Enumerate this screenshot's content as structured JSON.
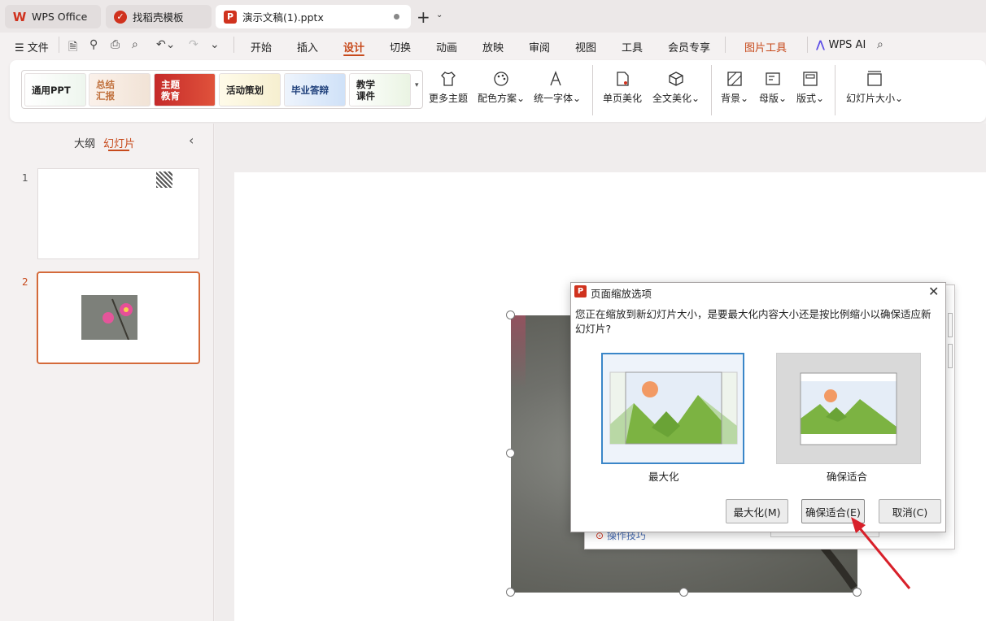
{
  "tabs": {
    "wps": "WPS Office",
    "templates": "找稻壳模板",
    "document": "演示文稿(1).pptx"
  },
  "menu": {
    "file": "文件",
    "items": [
      "开始",
      "插入",
      "设计",
      "切换",
      "动画",
      "放映",
      "审阅",
      "视图",
      "工具",
      "会员专享"
    ],
    "picture_tools": "图片工具",
    "wps_ai": "WPS AI"
  },
  "ribbon": {
    "themes": [
      "通用PPT",
      "总结汇报",
      "主题教育",
      "活动策划",
      "毕业答辩",
      "教学课件"
    ],
    "buttons": [
      "更多主题",
      "配色方案",
      "统一字体",
      "单页美化",
      "全文美化",
      "背景",
      "母版",
      "版式",
      "幻灯片大小"
    ]
  },
  "sidebar": {
    "tab_outline": "大纲",
    "tab_slides": "幻灯片",
    "slide_numbers": [
      "1",
      "2"
    ]
  },
  "back_dialog": {
    "tip": "操作技巧"
  },
  "dialog": {
    "title": "页面缩放选项",
    "message": "您正在缩放到新幻灯片大小，是要最大化内容大小还是按比例缩小以确保适应新幻灯片?",
    "option_maximize": "最大化",
    "option_fit": "确保适合",
    "btn_maximize": "最大化(M)",
    "btn_fit": "确保适合(E)",
    "btn_cancel": "取消(C)"
  },
  "colors": {
    "accent": "#c74a1c",
    "selection": "#3a86c8",
    "wps_red": "#d0321e",
    "arrow": "#d8202a"
  }
}
